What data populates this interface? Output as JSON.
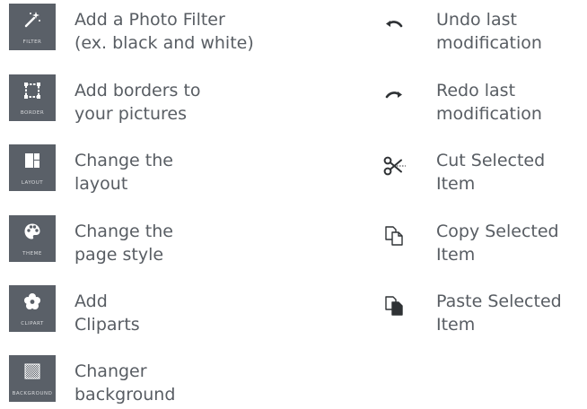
{
  "tools": [
    {
      "id": "filter",
      "caption": "FILTER",
      "icon": "magic-wand-icon",
      "line1": "Add a Photo Filter",
      "line2": "(ex. black and white)"
    },
    {
      "id": "border",
      "caption": "BORDER",
      "icon": "border-frame-icon",
      "line1": "Add borders to",
      "line2": "your pictures"
    },
    {
      "id": "layout",
      "caption": "LAYOUT",
      "icon": "layout-grid-icon",
      "line1": "Change the",
      "line2": "layout"
    },
    {
      "id": "theme",
      "caption": "THEME",
      "icon": "palette-icon",
      "line1": "Change the",
      "line2": "page style"
    },
    {
      "id": "clipart",
      "caption": "CLIPART",
      "icon": "flower-icon",
      "line1": "Add",
      "line2": "Cliparts"
    },
    {
      "id": "background",
      "caption": "BACKGROUND",
      "icon": "checkered-background-icon",
      "line1": "Changer",
      "line2": "background"
    }
  ],
  "actions": [
    {
      "id": "undo",
      "icon": "undo-icon",
      "line1": "Undo last",
      "line2": "modification"
    },
    {
      "id": "redo",
      "icon": "redo-icon",
      "line1": "Redo last",
      "line2": "modification"
    },
    {
      "id": "cut",
      "icon": "scissors-icon",
      "line1": "Cut Selected",
      "line2": "Item"
    },
    {
      "id": "copy",
      "icon": "copy-icon",
      "line1": "Copy Selected",
      "line2": "Item"
    },
    {
      "id": "paste",
      "icon": "paste-icon",
      "line1": "Paste Selected",
      "line2": "Item"
    }
  ],
  "colors": {
    "tile": "#5a6068",
    "text": "#585d63",
    "icon_dark": "#2f3235"
  }
}
